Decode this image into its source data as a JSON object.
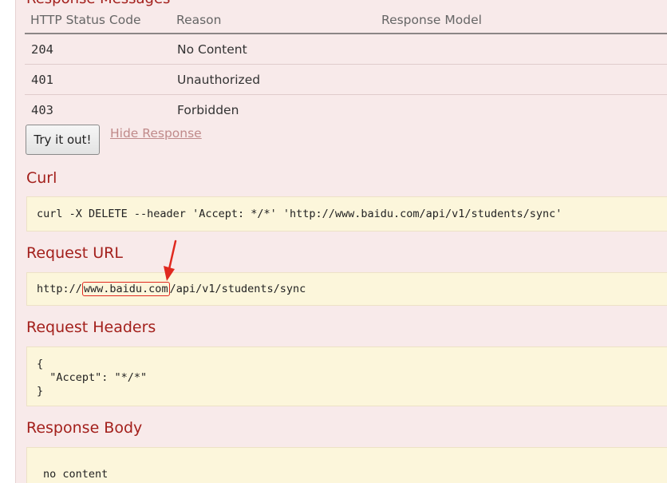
{
  "section": {
    "response_messages_title": "Response Messages"
  },
  "table": {
    "headers": [
      "HTTP Status Code",
      "Reason",
      "Response Model"
    ],
    "rows": [
      {
        "code": "204",
        "reason": "No Content",
        "model": ""
      },
      {
        "code": "401",
        "reason": "Unauthorized",
        "model": ""
      },
      {
        "code": "403",
        "reason": "Forbidden",
        "model": ""
      }
    ]
  },
  "actions": {
    "try_label": "Try it out!",
    "hide_label": "Hide Response"
  },
  "curl": {
    "title": "Curl",
    "command": "curl -X DELETE --header 'Accept: */*' 'http://www.baidu.com/api/v1/students/sync'"
  },
  "request_url": {
    "title": "Request URL",
    "prefix": "http://",
    "host": "www.baidu.com",
    "path": "/api/v1/students/sync"
  },
  "request_headers": {
    "title": "Request Headers",
    "open_brace": "{",
    "line": "  \"Accept\": \"*/*\"",
    "close_brace": "}"
  },
  "response_body": {
    "title": "Response Body",
    "text": "no content"
  },
  "annotation": {
    "color": "#e0291f"
  },
  "colors": {
    "heading": "#a3201c",
    "panel_bg": "#f8eaea",
    "code_bg": "#fcf6db",
    "link": "#c08a8a"
  }
}
